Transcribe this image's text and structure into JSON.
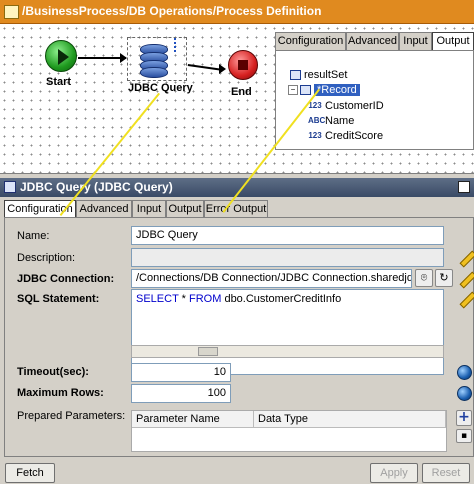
{
  "process": {
    "title": "/BusinessProcess/DB Operations/Process Definition",
    "nodes": {
      "start": "Start",
      "jdbc": "JDBC Query",
      "end": "End"
    }
  },
  "output_panel": {
    "tabs": [
      "Configuration",
      "Advanced",
      "Input",
      "Output"
    ],
    "selected_tab": "Output",
    "tree": {
      "root": "resultSet",
      "record": "*Record",
      "fields": [
        {
          "type": "123",
          "name": "CustomerID"
        },
        {
          "type": "ABC",
          "name": "Name"
        },
        {
          "type": "123",
          "name": "CreditScore"
        }
      ]
    }
  },
  "activity": {
    "title": "JDBC Query (JDBC Query)",
    "tabs": [
      "Configuration",
      "Advanced",
      "Input",
      "Output",
      "Error Output"
    ],
    "selected_tab": "Configuration",
    "form": {
      "name_label": "Name:",
      "name_value": "JDBC Query",
      "description_label": "Description:",
      "description_value": "",
      "connection_label": "JDBC Connection:",
      "connection_value": "/Connections/DB Connection/JDBC Connection.sharedjdbc",
      "sql_label": "SQL Statement:",
      "sql": {
        "kw1": "SELECT",
        "star": " * ",
        "kw2": "FROM",
        "rest": " dbo.CustomerCreditInfo"
      },
      "timeout_label": "Timeout(sec):",
      "timeout_value": "10",
      "max_rows_label": "Maximum Rows:",
      "max_rows_value": "100",
      "params_label": "Prepared Parameters:",
      "params_columns": [
        "Parameter Name",
        "Data Type"
      ]
    },
    "buttons": {
      "fetch": "Fetch",
      "apply": "Apply",
      "reset": "Reset"
    }
  },
  "colors": {
    "process_title": "#e08a1f",
    "panel_title": "#394a66",
    "annotation": "#f0e020"
  }
}
